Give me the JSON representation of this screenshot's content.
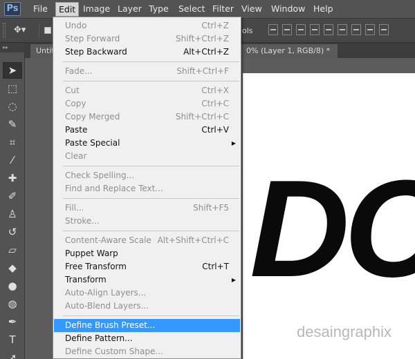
{
  "app": {
    "logo": "Ps"
  },
  "menubar": {
    "items": [
      {
        "label": "File",
        "active": false
      },
      {
        "label": "Edit",
        "active": true
      },
      {
        "label": "Image",
        "active": false
      },
      {
        "label": "Layer",
        "active": false
      },
      {
        "label": "Type",
        "active": false
      },
      {
        "label": "Select",
        "active": false
      },
      {
        "label": "Filter",
        "active": false
      },
      {
        "label": "View",
        "active": false
      },
      {
        "label": "Window",
        "active": false
      },
      {
        "label": "Help",
        "active": false
      }
    ]
  },
  "options_bar": {
    "partial_label": "ols"
  },
  "tabs": {
    "left_tab": "Untit",
    "right_tab": "0% (Layer 1, RGB/8) *",
    "close_glyph": "×"
  },
  "tools": [
    {
      "name": "move-tool-icon",
      "glyph": "➤"
    },
    {
      "name": "marquee-tool-icon",
      "glyph": "⬚"
    },
    {
      "name": "lasso-tool-icon",
      "glyph": "◌"
    },
    {
      "name": "quick-selection-tool-icon",
      "glyph": "✎"
    },
    {
      "name": "crop-tool-icon",
      "glyph": "⌗"
    },
    {
      "name": "eyedropper-tool-icon",
      "glyph": "⁄"
    },
    {
      "name": "healing-brush-tool-icon",
      "glyph": "✚"
    },
    {
      "name": "brush-tool-icon",
      "glyph": "✐"
    },
    {
      "name": "clone-stamp-tool-icon",
      "glyph": "♙"
    },
    {
      "name": "history-brush-tool-icon",
      "glyph": "↺"
    },
    {
      "name": "eraser-tool-icon",
      "glyph": "▱"
    },
    {
      "name": "paint-bucket-tool-icon",
      "glyph": "◆"
    },
    {
      "name": "blur-tool-icon",
      "glyph": "●"
    },
    {
      "name": "dodge-tool-icon",
      "glyph": "◍"
    },
    {
      "name": "pen-tool-icon",
      "glyph": "✒"
    },
    {
      "name": "type-tool-icon",
      "glyph": "T"
    },
    {
      "name": "path-selection-tool-icon",
      "glyph": "➚"
    }
  ],
  "edit_menu": {
    "items": [
      {
        "label": "Undo",
        "shortcut": "Ctrl+Z",
        "disabled": true
      },
      {
        "label": "Step Forward",
        "shortcut": "Shift+Ctrl+Z",
        "disabled": true
      },
      {
        "label": "Step Backward",
        "shortcut": "Alt+Ctrl+Z",
        "disabled": false
      },
      {
        "separator": true
      },
      {
        "label": "Fade...",
        "shortcut": "Shift+Ctrl+F",
        "disabled": true
      },
      {
        "separator": true
      },
      {
        "label": "Cut",
        "shortcut": "Ctrl+X",
        "disabled": true
      },
      {
        "label": "Copy",
        "shortcut": "Ctrl+C",
        "disabled": true
      },
      {
        "label": "Copy Merged",
        "shortcut": "Shift+Ctrl+C",
        "disabled": true
      },
      {
        "label": "Paste",
        "shortcut": "Ctrl+V",
        "disabled": false
      },
      {
        "label": "Paste Special",
        "shortcut": "",
        "disabled": false,
        "submenu": true
      },
      {
        "label": "Clear",
        "shortcut": "",
        "disabled": true
      },
      {
        "separator": true
      },
      {
        "label": "Check Spelling...",
        "shortcut": "",
        "disabled": true
      },
      {
        "label": "Find and Replace Text...",
        "shortcut": "",
        "disabled": true
      },
      {
        "separator": true
      },
      {
        "label": "Fill...",
        "shortcut": "Shift+F5",
        "disabled": true
      },
      {
        "label": "Stroke...",
        "shortcut": "",
        "disabled": true
      },
      {
        "separator": true
      },
      {
        "label": "Content-Aware Scale",
        "shortcut": "Alt+Shift+Ctrl+C",
        "disabled": true
      },
      {
        "label": "Puppet Warp",
        "shortcut": "",
        "disabled": false
      },
      {
        "label": "Free Transform",
        "shortcut": "Ctrl+T",
        "disabled": false
      },
      {
        "label": "Transform",
        "shortcut": "",
        "disabled": false,
        "submenu": true
      },
      {
        "label": "Auto-Align Layers...",
        "shortcut": "",
        "disabled": true
      },
      {
        "label": "Auto-Blend Layers...",
        "shortcut": "",
        "disabled": true
      },
      {
        "separator": true
      },
      {
        "label": "Define Brush Preset...",
        "shortcut": "",
        "disabled": false,
        "highlighted": true
      },
      {
        "label": "Define Pattern...",
        "shortcut": "",
        "disabled": false
      },
      {
        "label": "Define Custom Shape...",
        "shortcut": "",
        "disabled": true
      }
    ]
  },
  "canvas": {
    "big_text": "DC",
    "watermark": "desaingraphix"
  },
  "colors": {
    "highlight": "#3399ff",
    "menu_bg": "#f0f0f0",
    "chrome": "#535353"
  }
}
